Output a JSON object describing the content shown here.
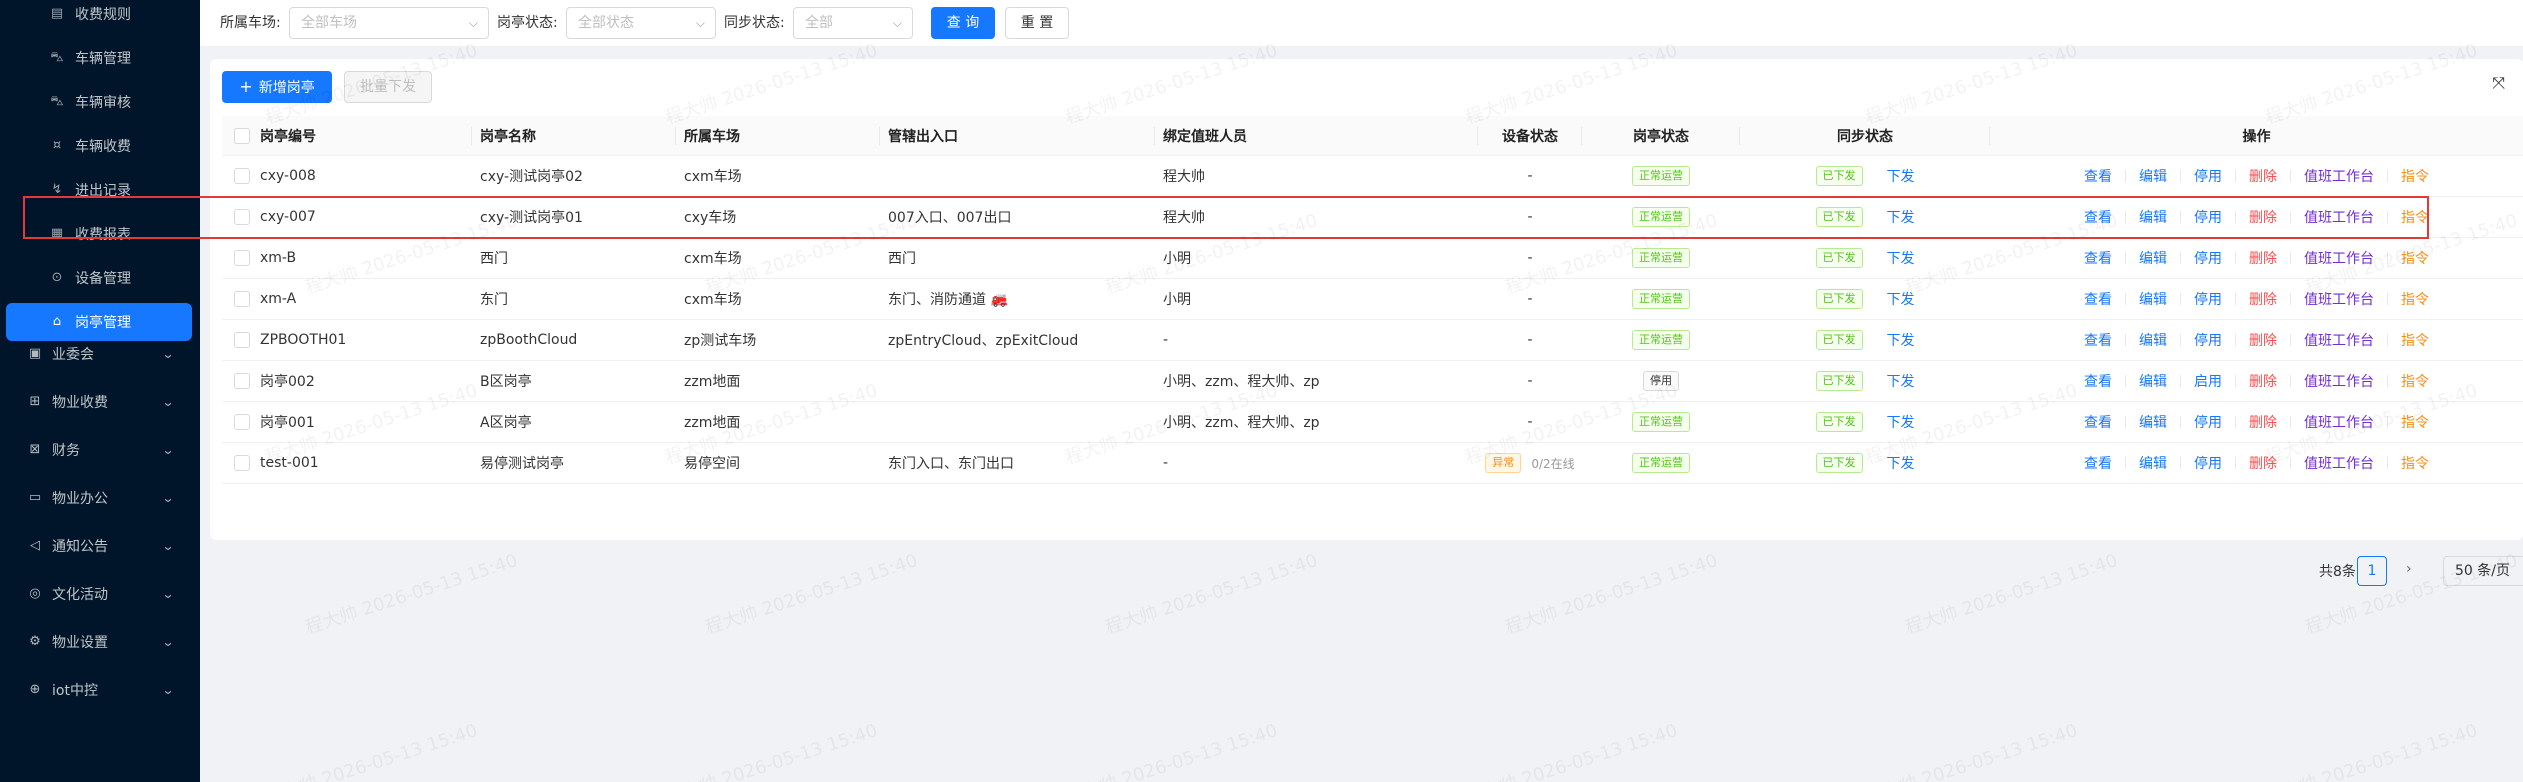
{
  "sidebar": {
    "sub_items": [
      {
        "label": "收费规则",
        "icon": "receipt-icon"
      },
      {
        "label": "车辆管理",
        "icon": "car-icon"
      },
      {
        "label": "车辆审核",
        "icon": "audit-icon"
      },
      {
        "label": "车辆收费",
        "icon": "coin-icon"
      },
      {
        "label": "进出记录",
        "icon": "record-icon"
      },
      {
        "label": "收费报表",
        "icon": "report-icon"
      },
      {
        "label": "设备管理",
        "icon": "device-icon"
      },
      {
        "label": "岗亭管理",
        "icon": "booth-icon",
        "active": true
      }
    ],
    "top_items": [
      {
        "label": "业委会",
        "icon": "committee-icon"
      },
      {
        "label": "物业收费",
        "icon": "fee-icon"
      },
      {
        "label": "财务",
        "icon": "finance-icon"
      },
      {
        "label": "物业办公",
        "icon": "office-icon"
      },
      {
        "label": "通知公告",
        "icon": "notice-icon"
      },
      {
        "label": "文化活动",
        "icon": "activity-icon"
      },
      {
        "label": "物业设置",
        "icon": "settings-icon"
      },
      {
        "label": "iot中控",
        "icon": "iot-icon"
      }
    ]
  },
  "filters": {
    "parking_label": "所属车场:",
    "parking_placeholder": "全部车场",
    "booth_status_label": "岗亭状态:",
    "booth_status_placeholder": "全部状态",
    "sync_status_label": "同步状态:",
    "sync_status_placeholder": "全部",
    "query_button": "查 询",
    "reset_button": "重 置"
  },
  "toolbar": {
    "add_button": "新增岗亭",
    "batch_button": "批量下发"
  },
  "table": {
    "headers": [
      "岗亭编号",
      "岗亭名称",
      "所属车场",
      "管辖出入口",
      "绑定值班人员",
      "设备状态",
      "岗亭状态",
      "同步状态",
      "操作"
    ],
    "rows": [
      {
        "code": "cxy-008",
        "name": "cxy-测试岗亭02",
        "lot": "cxm车场",
        "gates": "",
        "staff": "程大帅",
        "device": "-",
        "device_tag": "",
        "device_online": "",
        "status": "正常运营",
        "status_type": "green",
        "sync": "已下发",
        "sync_action": "下发",
        "ops": [
          "查看",
          "编辑",
          "停用",
          "删除",
          "值班工作台",
          "指令"
        ]
      },
      {
        "code": "cxy-007",
        "name": "cxy-测试岗亭01",
        "lot": "cxy车场",
        "gates": "007入口、007出口",
        "staff": "程大帅",
        "device": "-",
        "device_tag": "",
        "device_online": "",
        "status": "正常运营",
        "status_type": "green",
        "sync": "已下发",
        "sync_action": "下发",
        "ops": [
          "查看",
          "编辑",
          "停用",
          "删除",
          "值班工作台",
          "指令"
        ]
      },
      {
        "code": "xm-B",
        "name": "西门",
        "lot": "cxm车场",
        "gates": "西门",
        "staff": "小明",
        "device": "-",
        "device_tag": "",
        "device_online": "",
        "status": "正常运营",
        "status_type": "green",
        "sync": "已下发",
        "sync_action": "下发",
        "ops": [
          "查看",
          "编辑",
          "停用",
          "删除",
          "值班工作台",
          "指令"
        ]
      },
      {
        "code": "xm-A",
        "name": "东门",
        "lot": "cxm车场",
        "gates": "东门、消防通道 🚒",
        "staff": "小明",
        "device": "-",
        "device_tag": "",
        "device_online": "",
        "status": "正常运营",
        "status_type": "green",
        "sync": "已下发",
        "sync_action": "下发",
        "ops": [
          "查看",
          "编辑",
          "停用",
          "删除",
          "值班工作台",
          "指令"
        ]
      },
      {
        "code": "ZPBOOTH01",
        "name": "zpBoothCloud",
        "lot": "zp测试车场",
        "gates": "zpEntryCloud、zpExitCloud",
        "staff": "-",
        "device": "-",
        "device_tag": "",
        "device_online": "",
        "status": "正常运营",
        "status_type": "green",
        "sync": "已下发",
        "sync_action": "下发",
        "ops": [
          "查看",
          "编辑",
          "停用",
          "删除",
          "值班工作台",
          "指令"
        ]
      },
      {
        "code": "岗亭002",
        "name": "B区岗亭",
        "lot": "zzm地面",
        "gates": "",
        "staff": "小明、zzm、程大帅、zp",
        "device": "-",
        "device_tag": "",
        "device_online": "",
        "status": "停用",
        "status_type": "gray",
        "sync": "已下发",
        "sync_action": "下发",
        "ops": [
          "查看",
          "编辑",
          "启用",
          "删除",
          "值班工作台",
          "指令"
        ]
      },
      {
        "code": "岗亭001",
        "name": "A区岗亭",
        "lot": "zzm地面",
        "gates": "",
        "staff": "小明、zzm、程大帅、zp",
        "device": "-",
        "device_tag": "",
        "device_online": "",
        "status": "正常运营",
        "status_type": "green",
        "sync": "已下发",
        "sync_action": "下发",
        "ops": [
          "查看",
          "编辑",
          "停用",
          "删除",
          "值班工作台",
          "指令"
        ]
      },
      {
        "code": "test-001",
        "name": "易停测试岗亭",
        "lot": "易停空间",
        "gates": "东门入口、东门出口",
        "staff": "-",
        "device": "",
        "device_tag": "异常",
        "device_online": "0/2在线",
        "status": "正常运营",
        "status_type": "green",
        "sync": "已下发",
        "sync_action": "下发",
        "ops": [
          "查看",
          "编辑",
          "停用",
          "删除",
          "值班工作台",
          "指令"
        ]
      }
    ]
  },
  "pagination": {
    "total": "共8条",
    "current": "1",
    "page_size": "50 条/页"
  },
  "watermark": "程大帅 2026-05-13 15:40",
  "colors": {
    "sidebar_bg": "#001529",
    "primary": "#1677ff",
    "danger": "#ff4d4f",
    "purple": "#722ed1",
    "warning": "#fa8c16",
    "success": "#52c41a",
    "highlight_box": "#e53935"
  }
}
